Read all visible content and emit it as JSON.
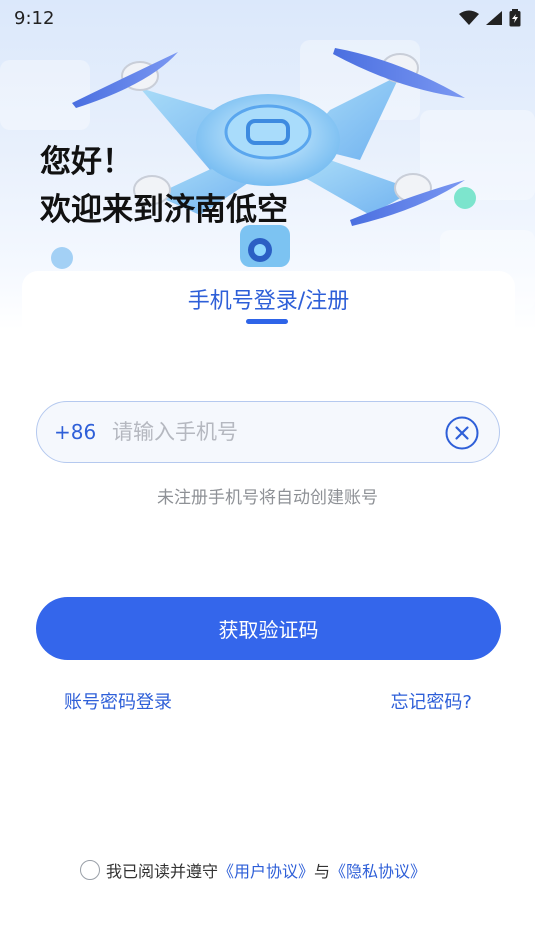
{
  "status_bar": {
    "time": "9:12"
  },
  "greeting": {
    "line1": "您好！",
    "line2": "欢迎来到济南低空"
  },
  "login": {
    "tab_label": "手机号登录/注册",
    "country_code": "+86",
    "phone_placeholder": "请输入手机号",
    "phone_value": "",
    "hint": "未注册手机号将自动创建账号",
    "submit_label": "获取验证码",
    "password_login_label": "账号密码登录",
    "forgot_password_label": "忘记密码?"
  },
  "agreement": {
    "prefix": "我已阅读并遵守",
    "user_agreement": "《用户协议》",
    "conjunction": "与",
    "privacy_policy": "《隐私协议》",
    "checked": false
  },
  "colors": {
    "accent": "#3466eb",
    "link": "#2e5fd8",
    "hint": "#8e9196"
  },
  "icons": [
    "wifi-icon",
    "signal-icon",
    "battery-icon",
    "drone-illustration",
    "clear-icon"
  ]
}
